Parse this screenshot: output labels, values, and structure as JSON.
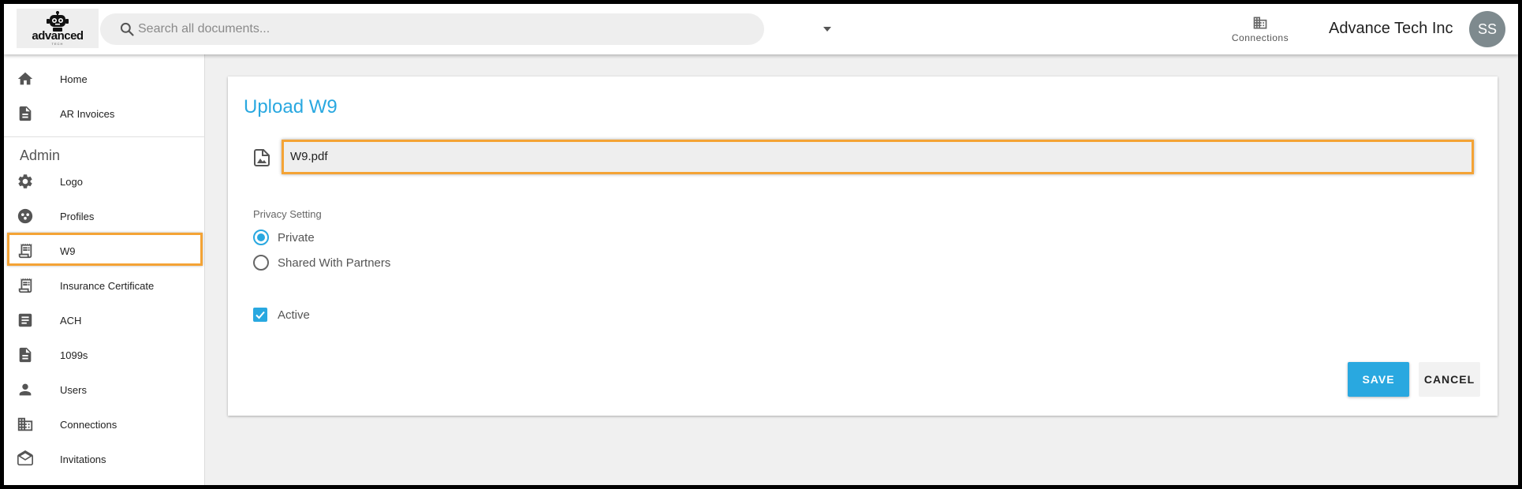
{
  "header": {
    "logo_text": "advanced",
    "logo_subtext": "TECH",
    "search_placeholder": "Search all documents...",
    "connections_label": "Connections",
    "company_name": "Advance Tech Inc",
    "avatar_initials": "SS"
  },
  "sidebar": {
    "top_items": [
      {
        "label": "Home",
        "icon": "home-icon"
      },
      {
        "label": "AR Invoices",
        "icon": "document-icon"
      }
    ],
    "admin_heading": "Admin",
    "admin_items": [
      {
        "label": "Logo",
        "icon": "gear-icon"
      },
      {
        "label": "Profiles",
        "icon": "profiles-icon"
      },
      {
        "label": "W9",
        "icon": "receipt-icon",
        "highlighted": true
      },
      {
        "label": "Insurance Certificate",
        "icon": "receipt-icon"
      },
      {
        "label": "ACH",
        "icon": "article-icon"
      },
      {
        "label": "1099s",
        "icon": "document-icon"
      },
      {
        "label": "Users",
        "icon": "person-icon"
      },
      {
        "label": "Connections",
        "icon": "building-icon"
      },
      {
        "label": "Invitations",
        "icon": "envelope-open-icon"
      }
    ]
  },
  "main": {
    "title": "Upload W9",
    "file_name": "W9.pdf",
    "privacy_label": "Privacy Setting",
    "privacy_options": [
      {
        "label": "Private",
        "selected": true
      },
      {
        "label": "Shared With Partners",
        "selected": false
      }
    ],
    "active_label": "Active",
    "active_checked": true,
    "save_label": "SAVE",
    "cancel_label": "CANCEL"
  },
  "colors": {
    "accent": "#29a8e0",
    "highlight": "#f4a335",
    "background": "#f0f0f0"
  }
}
